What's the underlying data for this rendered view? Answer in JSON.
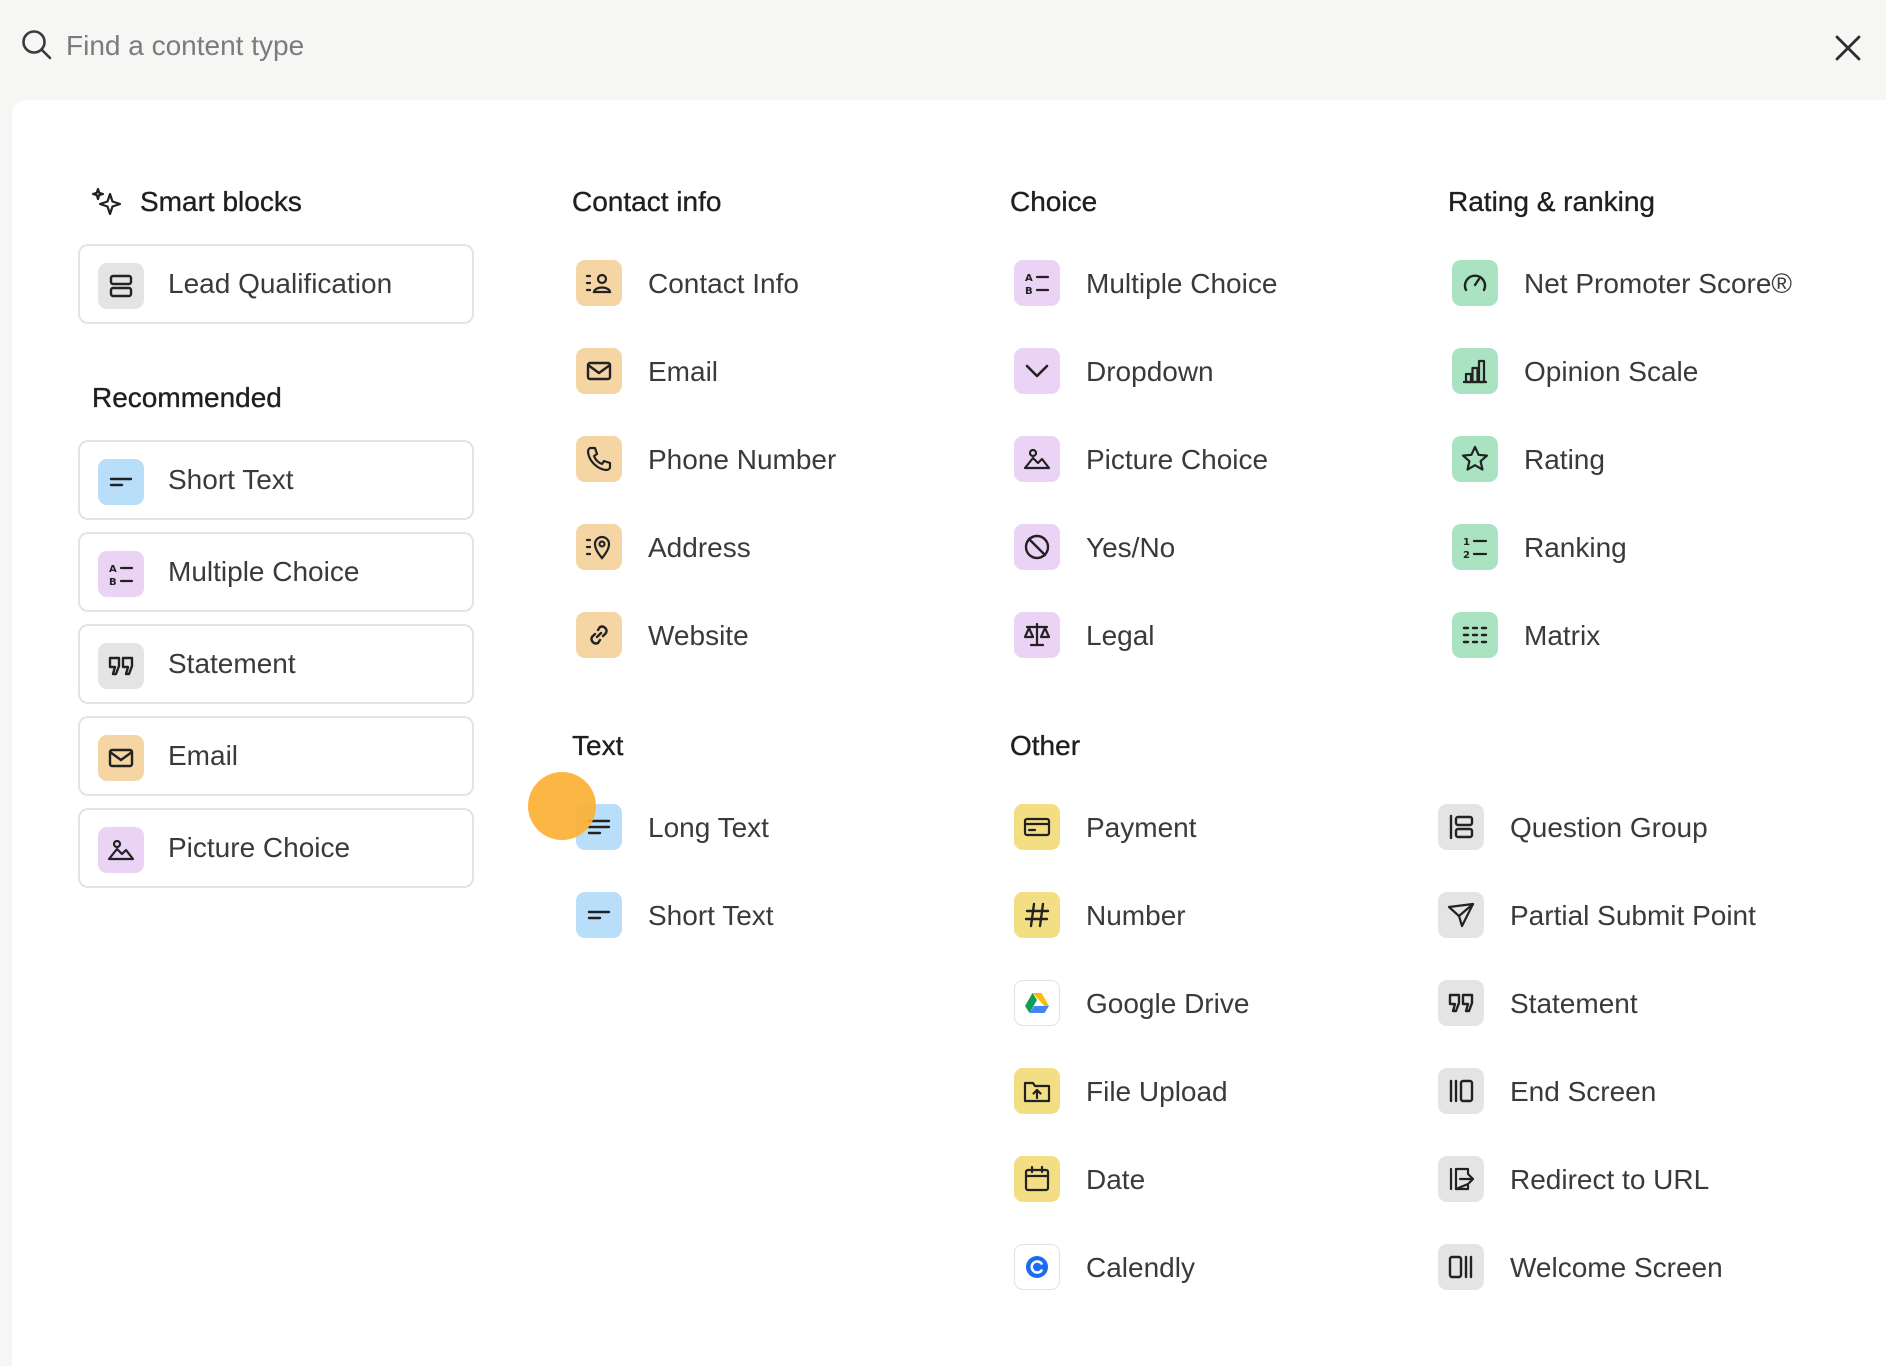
{
  "search": {
    "placeholder": "Find a content type"
  },
  "smart_blocks": {
    "title": "Smart blocks",
    "items": [
      {
        "label": "Lead Qualification",
        "icon": "stacked-boxes-icon",
        "color": "#e4e4e4"
      }
    ]
  },
  "recommended": {
    "title": "Recommended",
    "items": [
      {
        "label": "Short Text",
        "icon": "short-text-icon",
        "color": "#b8def9"
      },
      {
        "label": "Multiple Choice",
        "icon": "multiple-choice-icon",
        "color": "#ead3f4"
      },
      {
        "label": "Statement",
        "icon": "quote-icon",
        "color": "#e4e4e4"
      },
      {
        "label": "Email",
        "icon": "envelope-icon",
        "color": "#f6d5a5"
      },
      {
        "label": "Picture Choice",
        "icon": "picture-icon",
        "color": "#ead3f4"
      }
    ]
  },
  "contact_info": {
    "title": "Contact info",
    "items": [
      {
        "label": "Contact Info",
        "icon": "contact-card-icon"
      },
      {
        "label": "Email",
        "icon": "envelope-icon"
      },
      {
        "label": "Phone Number",
        "icon": "phone-icon"
      },
      {
        "label": "Address",
        "icon": "location-pin-icon"
      },
      {
        "label": "Website",
        "icon": "link-icon"
      }
    ]
  },
  "text": {
    "title": "Text",
    "items": [
      {
        "label": "Long Text",
        "icon": "long-text-icon"
      },
      {
        "label": "Short Text",
        "icon": "short-text-icon"
      }
    ]
  },
  "choice": {
    "title": "Choice",
    "items": [
      {
        "label": "Multiple Choice",
        "icon": "multiple-choice-icon"
      },
      {
        "label": "Dropdown",
        "icon": "chevron-down-icon"
      },
      {
        "label": "Picture Choice",
        "icon": "picture-icon"
      },
      {
        "label": "Yes/No",
        "icon": "yes-no-icon"
      },
      {
        "label": "Legal",
        "icon": "scales-icon"
      }
    ]
  },
  "rating": {
    "title": "Rating & ranking",
    "items": [
      {
        "label": "Net Promoter Score®",
        "icon": "gauge-icon"
      },
      {
        "label": "Opinion Scale",
        "icon": "bar-chart-icon"
      },
      {
        "label": "Rating",
        "icon": "star-icon"
      },
      {
        "label": "Ranking",
        "icon": "ranking-icon"
      },
      {
        "label": "Matrix",
        "icon": "matrix-icon"
      }
    ]
  },
  "other": {
    "title": "Other",
    "items": [
      {
        "label": "Payment",
        "icon": "credit-card-icon"
      },
      {
        "label": "Number",
        "icon": "hash-icon"
      },
      {
        "label": "Google Drive",
        "icon": "google-drive-icon"
      },
      {
        "label": "File Upload",
        "icon": "folder-upload-icon"
      },
      {
        "label": "Date",
        "icon": "calendar-icon"
      },
      {
        "label": "Calendly",
        "icon": "calendly-icon"
      }
    ],
    "items_right": [
      {
        "label": "Question Group",
        "icon": "question-group-icon"
      },
      {
        "label": "Partial Submit Point",
        "icon": "send-icon"
      },
      {
        "label": "Statement",
        "icon": "quote-icon"
      },
      {
        "label": "End Screen",
        "icon": "end-screen-icon"
      },
      {
        "label": "Redirect to URL",
        "icon": "redirect-icon"
      },
      {
        "label": "Welcome Screen",
        "icon": "welcome-screen-icon"
      }
    ]
  },
  "colors": {
    "contact": "#f6d5a5",
    "choice": "#ead3f4",
    "rating": "#a9e3c1",
    "text": "#b8def9",
    "other": "#f3de84",
    "neutral": "#e4e4e4",
    "cursor": "#fbb034"
  }
}
